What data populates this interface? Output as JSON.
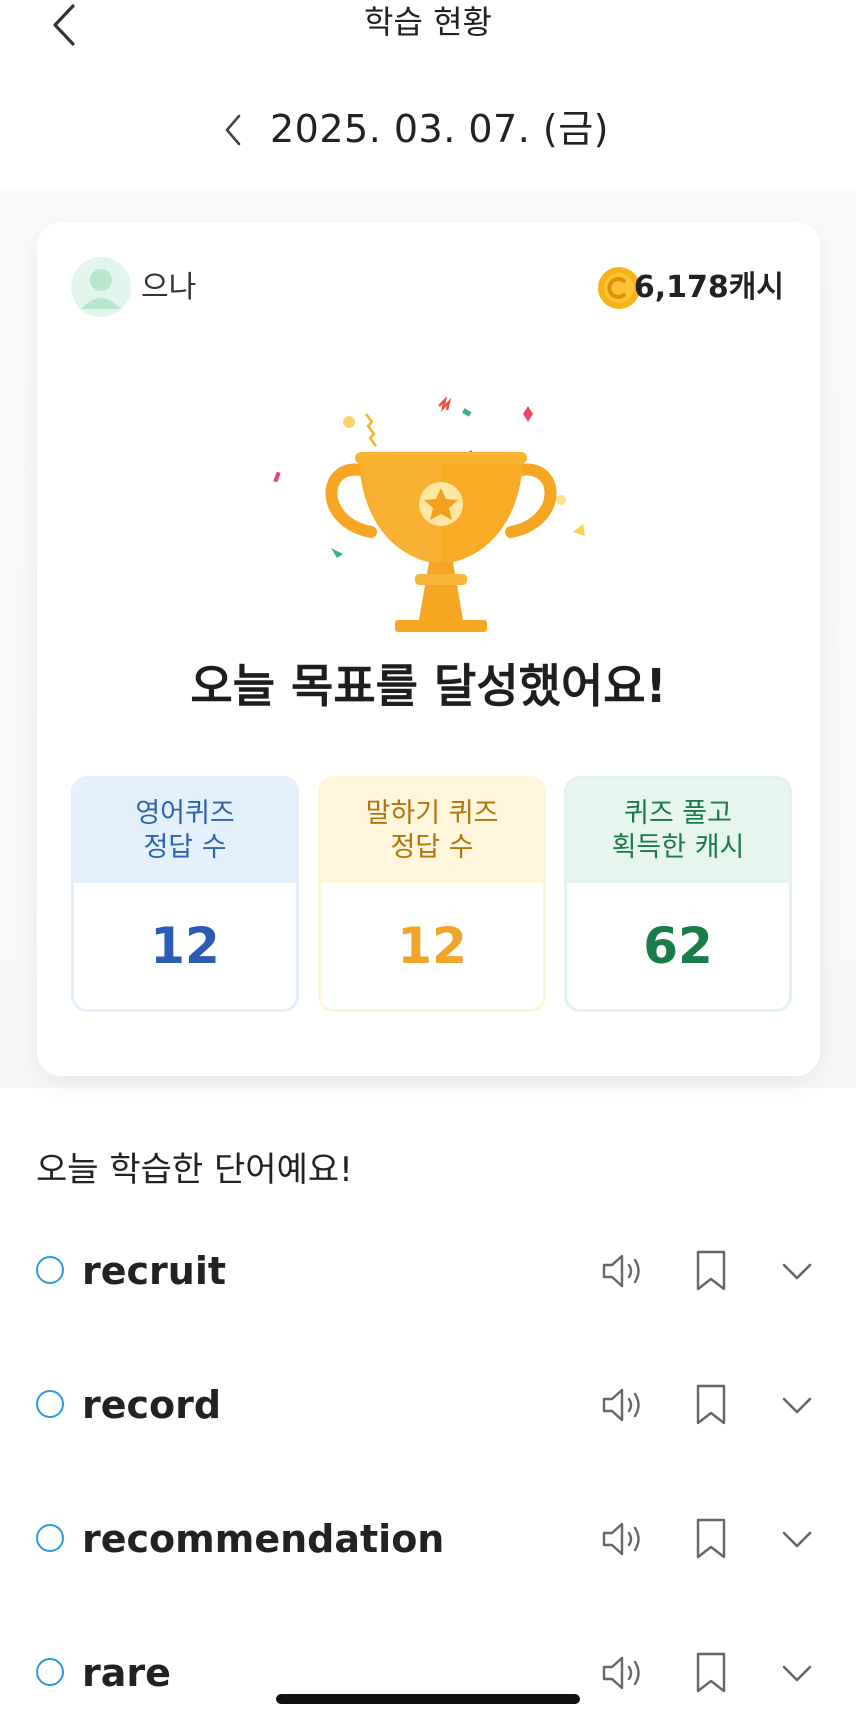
{
  "header": {
    "title": "학습 현황",
    "back_icon": "chevron-left-icon"
  },
  "date_nav": {
    "date": "2025. 03. 07. (금)",
    "prev_icon": "chevron-left-icon"
  },
  "profile": {
    "name": "으나",
    "cash": "6,178캐시",
    "coin_icon": "coin-icon"
  },
  "goal": {
    "title": "오늘 목표를 달성했어요!"
  },
  "stats": [
    {
      "line1": "영어퀴즈",
      "line2": "정답 수",
      "value": "12"
    },
    {
      "line1": "말하기 퀴즈",
      "line2": "정답 수",
      "value": "12"
    },
    {
      "line1": "퀴즈 풀고",
      "line2": "획득한 캐시",
      "value": "62"
    }
  ],
  "words_title": "오늘 학습한 단어예요!",
  "words": [
    {
      "word": "recruit"
    },
    {
      "word": "record"
    },
    {
      "word": "recommendation"
    },
    {
      "word": "rare"
    }
  ],
  "colors": {
    "accent_blue": "#2a5bb5",
    "accent_yellow": "#f0a52a",
    "accent_green": "#1b7c4b",
    "trophy": "#f6a623",
    "radio": "#2b9be0"
  }
}
